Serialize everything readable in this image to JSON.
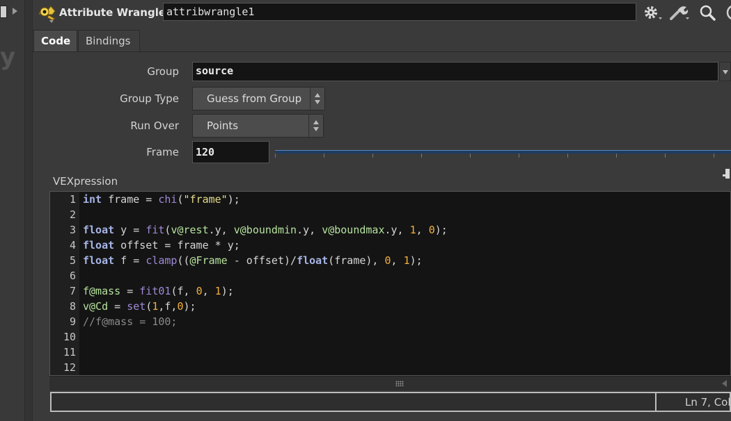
{
  "header": {
    "node_type": "Attribute Wrangle",
    "node_name": "attribwrangle1"
  },
  "tabs": [
    {
      "label": "Code",
      "active": true
    },
    {
      "label": "Bindings",
      "active": false
    }
  ],
  "params": {
    "group": {
      "label": "Group",
      "value": "source"
    },
    "group_type": {
      "label": "Group Type",
      "value": "Guess from Group"
    },
    "run_over": {
      "label": "Run Over",
      "value": "Points"
    },
    "frame": {
      "label": "Frame",
      "value": "120"
    }
  },
  "vex": {
    "label": "VEXpression",
    "line_numbers": [
      "1",
      "2",
      "3",
      "4",
      "5",
      "6",
      "7",
      "8",
      "9",
      "10",
      "11",
      "12"
    ],
    "lines": [
      "int frame = chi(\"frame\");",
      "",
      "float y = fit(v@rest.y, v@boundmin.y, v@boundmax.y, 1, 0);",
      "float offset = frame * y;",
      "float f = clamp((@Frame - offset)/float(frame), 0, 1);",
      "",
      "f@mass = fit01(f, 0, 1);",
      "v@Cd = set(1,f,0);",
      "//f@mass = 100;",
      "",
      "",
      ""
    ]
  },
  "status": {
    "message": "",
    "position": "Ln 7, Col"
  },
  "icons": {
    "left": [
      "panel-toggle-icon",
      "expand-arrow-icon"
    ],
    "header": [
      "node-type-icon",
      "gear-icon",
      "wrench-icon",
      "search-icon"
    ]
  },
  "colors": {
    "background": "#3a3a3a",
    "editor_background": "#141414",
    "keyword": "#a6b4e6",
    "function": "#9f8ad6",
    "string": "#e5dd8a",
    "number": "#f5b13c",
    "attribute": "#b6e29e",
    "comment": "#8a8a8a",
    "slider": "#1d3c62"
  }
}
